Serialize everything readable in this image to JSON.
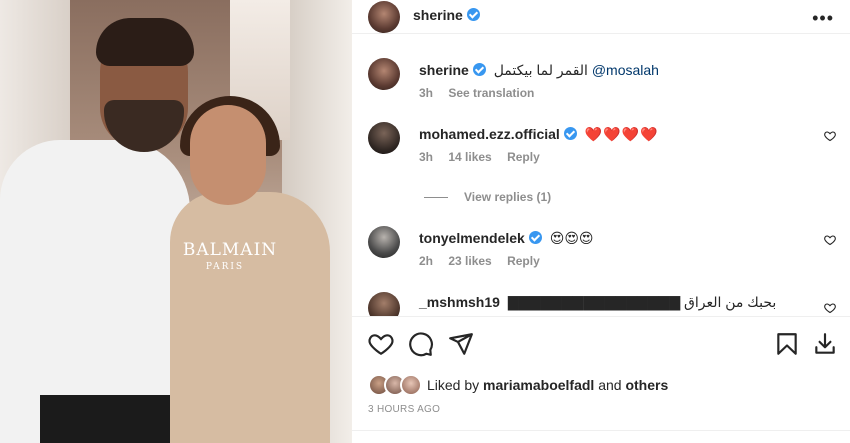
{
  "post": {
    "author": "sherine",
    "more_label": "•••"
  },
  "caption": {
    "username": "sherine",
    "text_rtl": "القمر لما بيكتمل",
    "mention": "@mosalah",
    "time": "3h",
    "see_translation": "See translation"
  },
  "comments": [
    {
      "username": "mohamed.ezz.official",
      "text": "❤️❤️❤️❤️",
      "time": "3h",
      "likes": "14 likes",
      "reply": "Reply",
      "view_replies": "View replies (1)"
    },
    {
      "username": "tonyelmendelek",
      "text": "😍😍😍",
      "time": "2h",
      "likes": "23 likes",
      "reply": "Reply"
    },
    {
      "username": "_mshmsh19",
      "text": "بحبك من العراق ▇▇▇▇▇▇▇▇▇▇▇▇▇▇▇▇"
    }
  ],
  "liked_by": {
    "prefix": "Liked by",
    "user": "mariamaboelfadl",
    "and": "and",
    "others": "others"
  },
  "timestamp": "3 HOURS AGO",
  "photo": {
    "brand": "BALMAIN",
    "brand_sub": "PARIS"
  },
  "colors": {
    "verified": "#3897f0",
    "heart": "#ed4956",
    "muted": "#8e8e8e",
    "mention": "#00376b"
  }
}
